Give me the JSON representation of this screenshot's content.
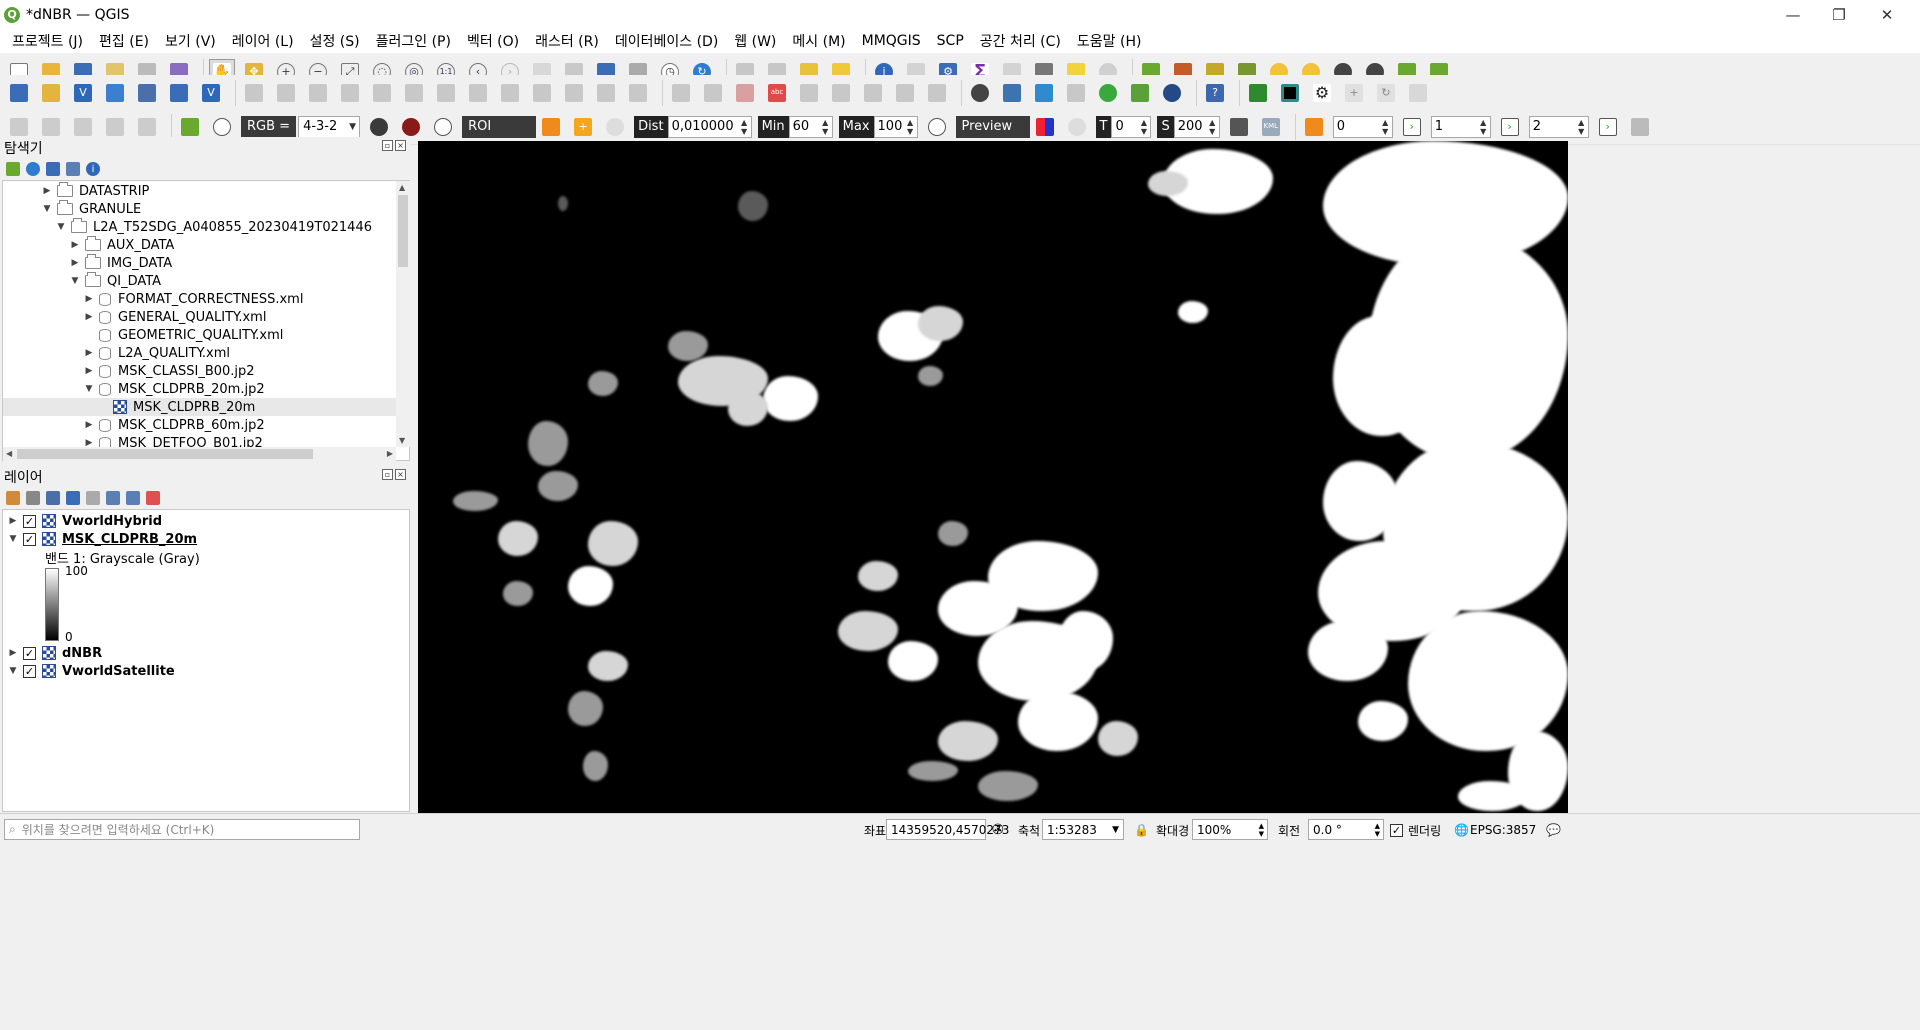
{
  "window": {
    "title": "*dNBR — QGIS",
    "logo": "Q",
    "controls": {
      "minimize": "—",
      "maximize": "❐",
      "close": "✕"
    }
  },
  "menu": [
    "프로젝트 (J)",
    "편집 (E)",
    "보기 (V)",
    "레이어 (L)",
    "설정 (S)",
    "플러그인 (P)",
    "벡터 (O)",
    "래스터 (R)",
    "데이터베이스 (D)",
    "웹 (W)",
    "메시 (M)",
    "MMQGIS",
    "SCP",
    "공간 처리 (C)",
    "도움말 (H)"
  ],
  "scp_toolbar": {
    "rgb_label": "RGB =",
    "rgb_value": "4-3-2",
    "roi_label": "ROI",
    "dist_label": "Dist",
    "dist_value": "0,010000",
    "min_label": "Min",
    "min_value": "60",
    "max_label": "Max",
    "max_value": "100",
    "preview_label": "Preview",
    "t_label": "T",
    "t_value": "0",
    "s_label": "S",
    "s_value": "200",
    "kml_label": "KML",
    "band_a": "0",
    "band_b": "1",
    "band_c": "2"
  },
  "browser": {
    "title": "탐색기",
    "items": [
      {
        "label": "DATASTRIP",
        "kind": "folder",
        "expanded": false
      },
      {
        "label": "GRANULE",
        "kind": "folder",
        "expanded": true
      },
      {
        "label": "L2A_T52SDG_A040855_20230419T021446",
        "kind": "folder",
        "expanded": true
      },
      {
        "label": "AUX_DATA",
        "kind": "folder",
        "expanded": false
      },
      {
        "label": "IMG_DATA",
        "kind": "folder",
        "expanded": false
      },
      {
        "label": "QI_DATA",
        "kind": "folder",
        "expanded": true
      },
      {
        "label": "FORMAT_CORRECTNESS.xml",
        "kind": "db",
        "expanded": false
      },
      {
        "label": "GENERAL_QUALITY.xml",
        "kind": "db",
        "expanded": false
      },
      {
        "label": "GEOMETRIC_QUALITY.xml",
        "kind": "db",
        "expanded": null
      },
      {
        "label": "L2A_QUALITY.xml",
        "kind": "db",
        "expanded": false
      },
      {
        "label": "MSK_CLASSI_B00.jp2",
        "kind": "db",
        "expanded": false
      },
      {
        "label": "MSK_CLDPRB_20m.jp2",
        "kind": "db",
        "expanded": true
      },
      {
        "label": "MSK_CLDPRB_20m",
        "kind": "raster",
        "expanded": null,
        "selected": true
      },
      {
        "label": "MSK_CLDPRB_60m.jp2",
        "kind": "db",
        "expanded": false
      },
      {
        "label": "MSK_DETFOO_B01.jp2",
        "kind": "db",
        "expanded": false
      }
    ]
  },
  "layers": {
    "title": "레이어",
    "items": [
      {
        "label": "VworldHybrid",
        "checked": true,
        "expanded": false,
        "underlined": false
      },
      {
        "label": "MSK_CLDPRB_20m",
        "checked": true,
        "expanded": true,
        "underlined": true
      },
      {
        "label": "dNBR",
        "checked": true,
        "expanded": false,
        "underlined": false
      },
      {
        "label": "VworldSatellite",
        "checked": true,
        "expanded": true,
        "underlined": false
      }
    ],
    "legend": {
      "band_label": "밴드 1: Grayscale (Gray)",
      "max": "100",
      "min": "0"
    }
  },
  "statusbar": {
    "search_placeholder": "위치를 찾으려면 입력하세요 (Ctrl+K)",
    "coord_label": "좌표",
    "coord_value": "14359520,4570273",
    "scale_label": "축척",
    "scale_value": "1:53283",
    "magnifier_label": "확대경",
    "magnifier_value": "100%",
    "rotation_label": "회전",
    "rotation_value": "0.0 °",
    "render_label": "렌더링",
    "crs": "EPSG:3857"
  },
  "colors": {
    "map_background": "#000000",
    "cloud": "#ffffff",
    "qgis_green": "#5aa13a",
    "scp_dark": "#3a3a3a"
  }
}
